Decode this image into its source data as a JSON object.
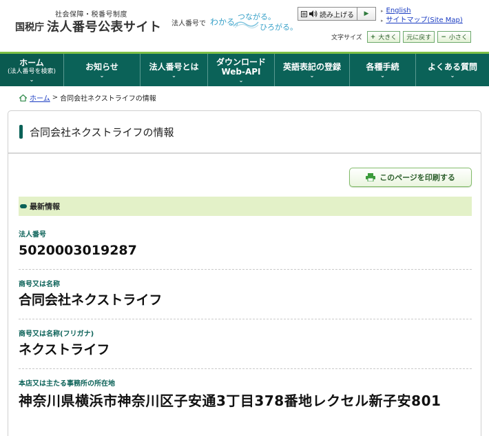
{
  "header": {
    "logo_sub": "社会保障・税番号制度",
    "logo_agency": "国税庁",
    "logo_site": "法人番号公表サイト",
    "tagline_prefix": "法人番号で",
    "tagline_1": "わかる。",
    "tagline_2": "つながる。",
    "tagline_3": "ひろがる。",
    "read_aloud": "読み上げる",
    "links": [
      "English",
      "サイトマップ(Site Map)"
    ],
    "font_size_label": "文字サイズ",
    "font_size_buttons": [
      {
        "symbol": "+",
        "label": "大きく"
      },
      {
        "symbol": "",
        "label": "元に戻す"
      },
      {
        "symbol": "−",
        "label": "小さく"
      }
    ]
  },
  "nav": [
    {
      "label": "ホーム",
      "sub": "(法人番号を検索)",
      "active": true
    },
    {
      "label": "お知らせ",
      "sub": ""
    },
    {
      "label": "法人番号とは",
      "sub": ""
    },
    {
      "label": "ダウンロード",
      "sub": "Web-API"
    },
    {
      "label": "英語表記の登録",
      "sub": ""
    },
    {
      "label": "各種手続",
      "sub": ""
    },
    {
      "label": "よくある質問",
      "sub": ""
    }
  ],
  "breadcrumb": {
    "home": "ホーム",
    "separator": ">",
    "current": "合同会社ネクストライフの情報"
  },
  "panel": {
    "title": "合同会社ネクストライフの情報",
    "print_button": "このページを印刷する",
    "section": "最新情報",
    "fields": [
      {
        "label": "法人番号",
        "value": "5020003019287"
      },
      {
        "label": "商号又は名称",
        "value": "合同会社ネクストライフ"
      },
      {
        "label": "商号又は名称(フリガナ)",
        "value": "ネクストライフ"
      },
      {
        "label": "本店又は主たる事務所の所在地",
        "value": "神奈川県横浜市神奈川区子安通3丁目378番地レクセル新子安801"
      }
    ]
  },
  "colors": {
    "nav_bg": "#0b6258",
    "accent_green": "#7cbf46",
    "section_bg": "#e3f1c8",
    "link": "#1a3cc2"
  }
}
